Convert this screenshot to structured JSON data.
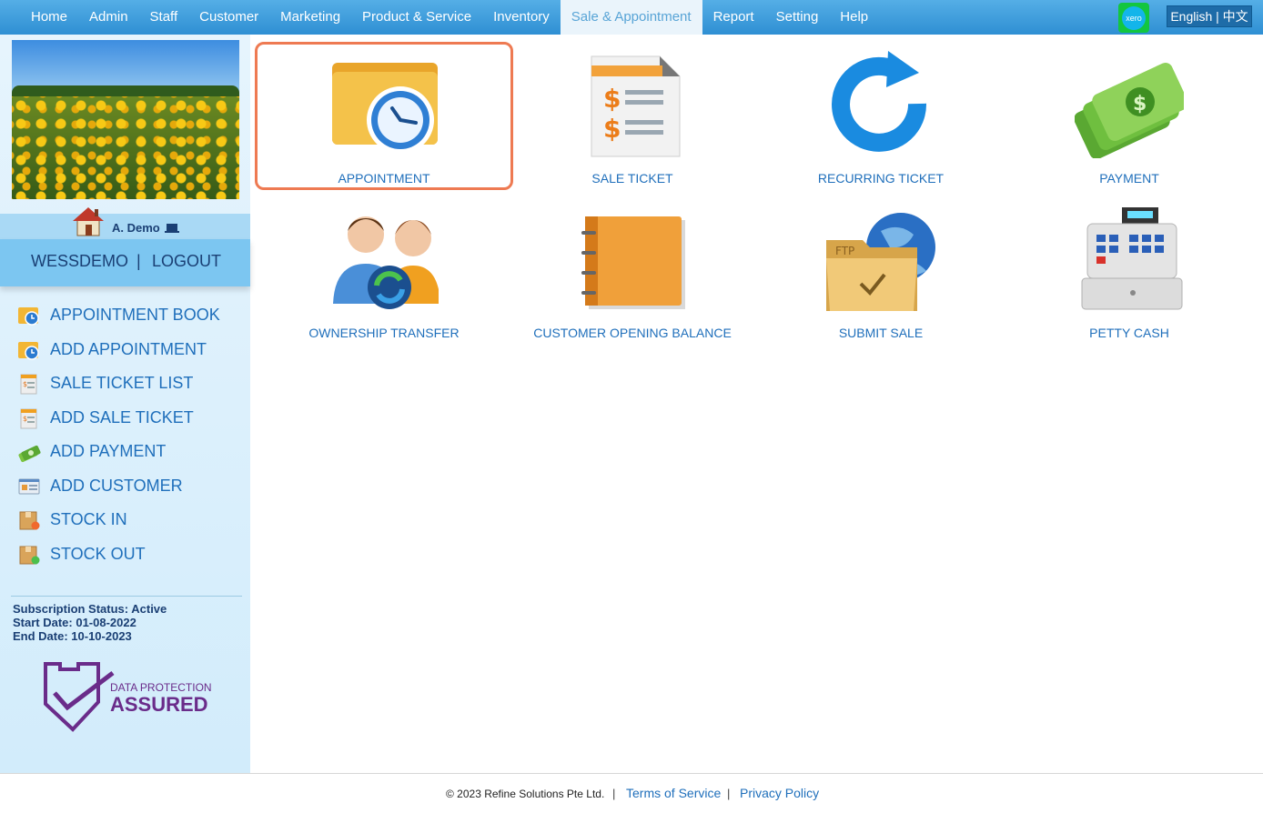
{
  "nav": {
    "items": [
      "Home",
      "Admin",
      "Staff",
      "Customer",
      "Marketing",
      "Product & Service",
      "Inventory",
      "Sale & Appointment",
      "Report",
      "Setting",
      "Help"
    ],
    "active": "Sale & Appointment",
    "xero_label": "xero",
    "language": "English | 中文"
  },
  "user": {
    "name": "A. Demo",
    "account": "WESSDEMO",
    "logout": "LOGOUT",
    "separator": "|"
  },
  "sidebar": {
    "menu": [
      {
        "label": "APPOINTMENT BOOK",
        "icon": "appointment-icon"
      },
      {
        "label": "ADD APPOINTMENT",
        "icon": "appointment-icon"
      },
      {
        "label": "SALE TICKET LIST",
        "icon": "sale-ticket-icon"
      },
      {
        "label": "ADD SALE TICKET",
        "icon": "sale-ticket-icon"
      },
      {
        "label": "ADD PAYMENT",
        "icon": "money-icon"
      },
      {
        "label": "ADD CUSTOMER",
        "icon": "customer-card-icon"
      },
      {
        "label": "STOCK IN",
        "icon": "stock-in-icon"
      },
      {
        "label": "STOCK OUT",
        "icon": "stock-out-icon"
      }
    ],
    "subscription": {
      "status": "Subscription Status: Active",
      "start": "Start Date: 01-08-2022",
      "end": "End Date: 10-10-2023"
    },
    "badge": {
      "line1": "DATA PROTECTION",
      "line2": "ASSURED"
    }
  },
  "tiles": [
    {
      "label": "APPOINTMENT",
      "icon": "appointment-folder-icon",
      "selected": true
    },
    {
      "label": "SALE TICKET",
      "icon": "sale-ticket-document-icon"
    },
    {
      "label": "RECURRING TICKET",
      "icon": "recurring-arrow-icon"
    },
    {
      "label": "PAYMENT",
      "icon": "money-stack-icon"
    },
    {
      "label": "OWNERSHIP TRANSFER",
      "icon": "people-transfer-icon"
    },
    {
      "label": "CUSTOMER OPENING BALANCE",
      "icon": "notebook-icon"
    },
    {
      "label": "SUBMIT SALE",
      "icon": "ftp-folder-icon"
    },
    {
      "label": "PETTY CASH",
      "icon": "cash-register-icon"
    }
  ],
  "footer": {
    "copyright": "© 2023 Refine Solutions Pte Ltd.",
    "separator": "|",
    "terms": "Terms of Service",
    "privacy": "Privacy Policy"
  },
  "colors": {
    "nav": "#2f8fd3",
    "link": "#1f6fbb",
    "selected_border": "#ee7a52",
    "sidebar": "#d2ecfb"
  }
}
